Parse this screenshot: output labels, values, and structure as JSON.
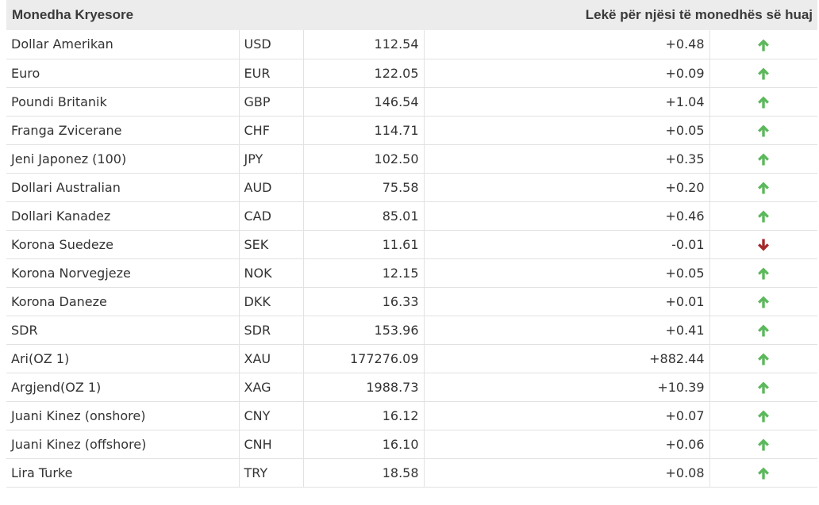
{
  "table": {
    "header": {
      "title": "Monedha Kryesore",
      "subtitle": "Lekë për njësi të monedhës së huaj"
    },
    "colors": {
      "up": "#5cb85c",
      "down": "#a52a2a",
      "header_bg": "#ececec",
      "border": "#e2e2e2"
    },
    "rows": [
      {
        "name": "Dollar Amerikan",
        "code": "USD",
        "rate": "112.54",
        "change": "+0.48",
        "direction": "up"
      },
      {
        "name": "Euro",
        "code": "EUR",
        "rate": "122.05",
        "change": "+0.09",
        "direction": "up"
      },
      {
        "name": "Poundi Britanik",
        "code": "GBP",
        "rate": "146.54",
        "change": "+1.04",
        "direction": "up"
      },
      {
        "name": "Franga Zvicerane",
        "code": "CHF",
        "rate": "114.71",
        "change": "+0.05",
        "direction": "up"
      },
      {
        "name": "Jeni Japonez (100)",
        "code": "JPY",
        "rate": "102.50",
        "change": "+0.35",
        "direction": "up"
      },
      {
        "name": "Dollari Australian",
        "code": "AUD",
        "rate": "75.58",
        "change": "+0.20",
        "direction": "up"
      },
      {
        "name": "Dollari Kanadez",
        "code": "CAD",
        "rate": "85.01",
        "change": "+0.46",
        "direction": "up"
      },
      {
        "name": "Korona Suedeze",
        "code": "SEK",
        "rate": "11.61",
        "change": "-0.01",
        "direction": "down"
      },
      {
        "name": "Korona Norvegjeze",
        "code": "NOK",
        "rate": "12.15",
        "change": "+0.05",
        "direction": "up"
      },
      {
        "name": "Korona Daneze",
        "code": "DKK",
        "rate": "16.33",
        "change": "+0.01",
        "direction": "up"
      },
      {
        "name": "SDR",
        "code": "SDR",
        "rate": "153.96",
        "change": "+0.41",
        "direction": "up"
      },
      {
        "name": "Ari(OZ 1)",
        "code": "XAU",
        "rate": "177276.09",
        "change": "+882.44",
        "direction": "up"
      },
      {
        "name": "Argjend(OZ 1)",
        "code": "XAG",
        "rate": "1988.73",
        "change": "+10.39",
        "direction": "up"
      },
      {
        "name": "Juani Kinez (onshore)",
        "code": "CNY",
        "rate": "16.12",
        "change": "+0.07",
        "direction": "up"
      },
      {
        "name": "Juani Kinez (offshore)",
        "code": "CNH",
        "rate": "16.10",
        "change": "+0.06",
        "direction": "up"
      },
      {
        "name": "Lira Turke",
        "code": "TRY",
        "rate": "18.58",
        "change": "+0.08",
        "direction": "up"
      }
    ]
  }
}
